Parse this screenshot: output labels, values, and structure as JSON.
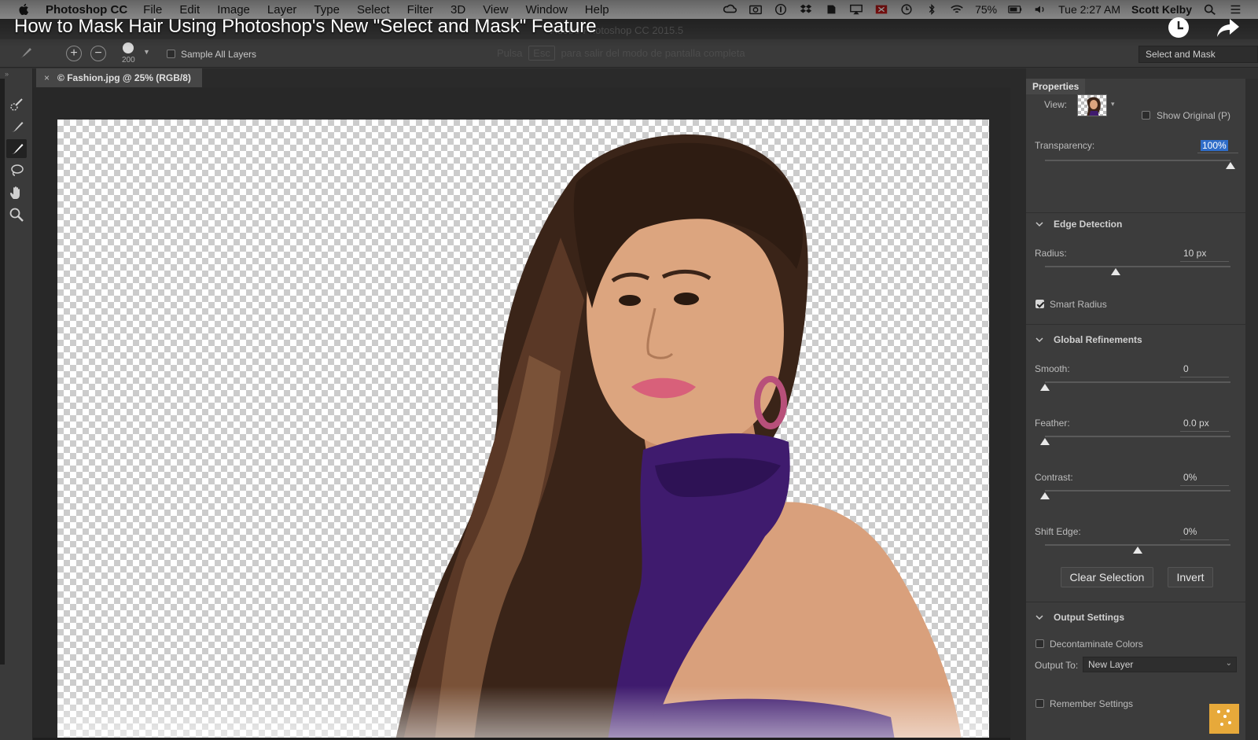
{
  "menubar": {
    "app_name": "Photoshop CC",
    "items": [
      "File",
      "Edit",
      "Image",
      "Layer",
      "Type",
      "Select",
      "Filter",
      "3D",
      "View",
      "Window",
      "Help"
    ],
    "battery": "75%",
    "clock": "Tue 2:27 AM",
    "user": "Scott Kelby"
  },
  "video": {
    "title": "How to Mask Hair Using Photoshop's New \"Select and Mask\" Feature"
  },
  "window": {
    "title": "Adobe Photoshop CC 2015.5"
  },
  "options": {
    "brush_size": "200",
    "sample_all_layers": "Sample All Layers",
    "esc_hint_pre": "Pulsa",
    "esc_key": "Esc",
    "esc_hint_post": "para salir del modo de pantalla completa",
    "workspace": "Select and Mask"
  },
  "document": {
    "tab_label": "© Fashion.jpg @ 25% (RGB/8)"
  },
  "properties": {
    "tab": "Properties",
    "view_label": "View:",
    "show_original": "Show Original (P)",
    "transparency_label": "Transparency:",
    "transparency_value": "100%",
    "transparency_level": 1.0,
    "edge_detection": {
      "title": "Edge Detection",
      "radius_label": "Radius:",
      "radius_value": "10 px",
      "radius_level": 0.38,
      "smart_radius": "Smart Radius",
      "smart_radius_checked": true
    },
    "global_refinements": {
      "title": "Global Refinements",
      "smooth_label": "Smooth:",
      "smooth_value": "0",
      "smooth_level": 0.0,
      "feather_label": "Feather:",
      "feather_value": "0.0 px",
      "feather_level": 0.0,
      "contrast_label": "Contrast:",
      "contrast_value": "0%",
      "contrast_level": 0.0,
      "shift_edge_label": "Shift Edge:",
      "shift_edge_value": "0%",
      "shift_edge_level": 0.5
    },
    "clear_selection": "Clear Selection",
    "invert": "Invert",
    "output_settings": {
      "title": "Output Settings",
      "decontaminate": "Decontaminate Colors",
      "output_to_label": "Output To:",
      "output_to_value": "New Layer",
      "remember": "Remember Settings"
    }
  },
  "colors": {
    "panel_bg": "#3c3c3c",
    "selection_highlight": "#2f6dc9",
    "scarf_purple": "#3f1b6e"
  }
}
